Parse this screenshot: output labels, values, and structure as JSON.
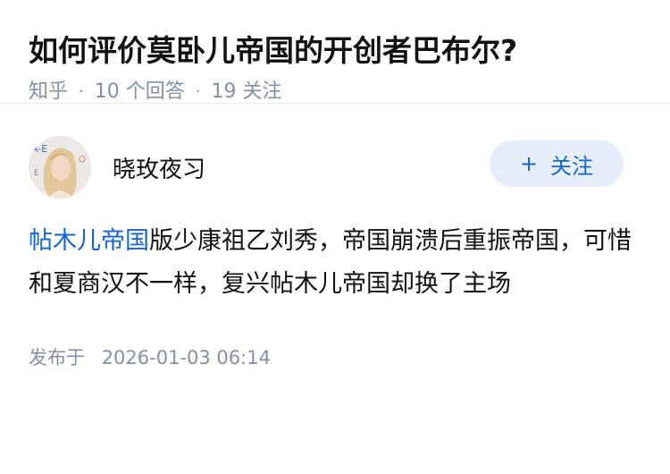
{
  "question": {
    "title": "如何评价莫卧儿帝国的开创者巴布尔?",
    "source": "知乎",
    "separator": "·",
    "answers_count": "10 个回答",
    "followers_count": "19 关注"
  },
  "answer": {
    "author_name": "晓玫夜习",
    "follow_button": {
      "plus": "+",
      "label": "关注"
    },
    "content_link": "帖木儿帝国",
    "content_text": "版少康祖乙刘秀，帝国崩溃后重振帝国，可惜和夏商汉不一样，复兴帖木儿帝国却换了主场",
    "published_label": "发布于",
    "published_time": "2026-01-03 06:14"
  },
  "colors": {
    "link": "#1766d0",
    "meta": "#8590a6",
    "follow_bg": "#e5eefa"
  }
}
